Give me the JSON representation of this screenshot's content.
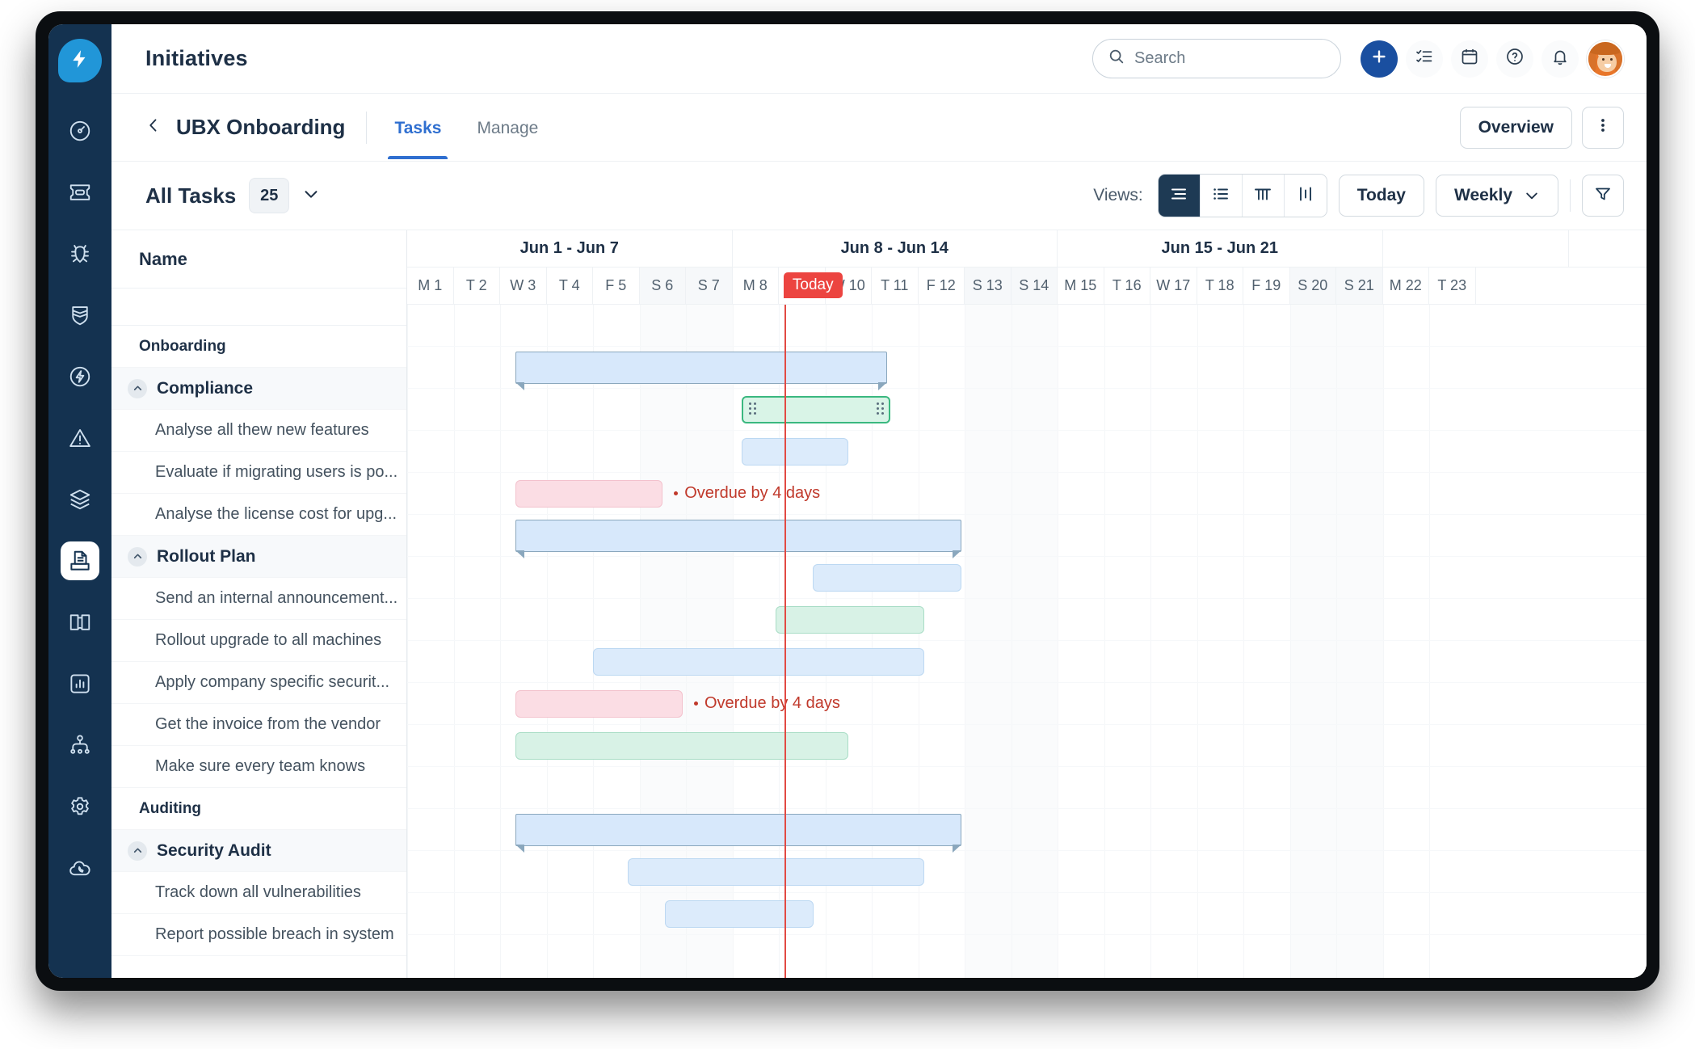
{
  "app": {
    "page_title": "Initiatives",
    "accent_blue": "#1a4fa0",
    "rail_bg": "#143250",
    "today_red": "#ec4440"
  },
  "sidebar": {
    "logo_icon": "lightning-bolt-icon",
    "items": [
      {
        "icon": "gauge-icon",
        "name": "dashboard",
        "active": false
      },
      {
        "icon": "ticket-icon",
        "name": "tickets",
        "active": false
      },
      {
        "icon": "bug-icon",
        "name": "bugs",
        "active": false
      },
      {
        "icon": "shield-icon",
        "name": "security",
        "active": false
      },
      {
        "icon": "bolt-circle-icon",
        "name": "automations",
        "active": false
      },
      {
        "icon": "warning-icon",
        "name": "incidents",
        "active": false
      },
      {
        "icon": "layers-icon",
        "name": "assets",
        "active": false
      },
      {
        "icon": "document-inbox-icon",
        "name": "initiatives",
        "active": true
      },
      {
        "icon": "book-icon",
        "name": "knowledge",
        "active": false
      },
      {
        "icon": "bar-chart-icon",
        "name": "reports",
        "active": false
      },
      {
        "icon": "org-chart-icon",
        "name": "teams",
        "active": false
      },
      {
        "icon": "gear-icon",
        "name": "settings",
        "active": false
      },
      {
        "icon": "cloud-phone-icon",
        "name": "voice",
        "active": false
      }
    ]
  },
  "header": {
    "search": {
      "placeholder": "Search",
      "value": "",
      "icon": "search-icon"
    },
    "actions": [
      {
        "icon": "plus-icon",
        "name": "create-button"
      },
      {
        "icon": "checklist-icon",
        "name": "tasks-button"
      },
      {
        "icon": "calendar-icon",
        "name": "calendar-button"
      },
      {
        "icon": "help-icon",
        "name": "help-button"
      },
      {
        "icon": "bell-icon",
        "name": "notifications-button"
      }
    ],
    "avatar_alt": "user avatar"
  },
  "subheader": {
    "back_icon": "chevron-left-icon",
    "breadcrumb": "UBX Onboarding",
    "tabs": [
      {
        "label": "Tasks",
        "selected": true
      },
      {
        "label": "Manage",
        "selected": false
      }
    ],
    "overview_label": "Overview",
    "more_icon": "kebab-menu-icon"
  },
  "toolbar": {
    "title": "All Tasks",
    "count": "25",
    "chevron_icon": "chevron-down-icon",
    "views_label": "Views:",
    "view_buttons": [
      {
        "icon": "gantt-view-icon",
        "name": "view-gantt",
        "active": true
      },
      {
        "icon": "list-view-icon",
        "name": "view-list",
        "active": false
      },
      {
        "icon": "timeline-view-icon",
        "name": "view-timeline",
        "active": false
      },
      {
        "icon": "board-view-icon",
        "name": "view-board",
        "active": false
      }
    ],
    "today_label": "Today",
    "zoom_label": "Weekly",
    "filter_icon": "filter-icon"
  },
  "gantt": {
    "name_header": "Name",
    "today_label": "Today",
    "today_day_index": 8,
    "weeks": [
      {
        "label": "Jun 1 - Jun 7",
        "days": 7
      },
      {
        "label": "Jun 8 - Jun 14",
        "days": 7
      },
      {
        "label": "Jun 15 - Jun 21",
        "days": 7
      },
      {
        "label": "",
        "days": 4
      }
    ],
    "days": [
      {
        "label": "M 1",
        "weekend": false
      },
      {
        "label": "T 2",
        "weekend": false
      },
      {
        "label": "W 3",
        "weekend": false
      },
      {
        "label": "T 4",
        "weekend": false
      },
      {
        "label": "F 5",
        "weekend": false
      },
      {
        "label": "S 6",
        "weekend": true
      },
      {
        "label": "S 7",
        "weekend": true
      },
      {
        "label": "M 8",
        "weekend": false
      },
      {
        "label": "T 9",
        "weekend": false
      },
      {
        "label": "W 10",
        "weekend": false
      },
      {
        "label": "T 11",
        "weekend": false
      },
      {
        "label": "F 12",
        "weekend": false
      },
      {
        "label": "S 13",
        "weekend": true
      },
      {
        "label": "S 14",
        "weekend": true
      },
      {
        "label": "M 15",
        "weekend": false
      },
      {
        "label": "T 16",
        "weekend": false
      },
      {
        "label": "W 17",
        "weekend": false
      },
      {
        "label": "T 18",
        "weekend": false
      },
      {
        "label": "F 19",
        "weekend": false
      },
      {
        "label": "S 20",
        "weekend": true
      },
      {
        "label": "S 21",
        "weekend": true
      },
      {
        "label": "M 22",
        "weekend": false
      },
      {
        "label": "T 23",
        "weekend": false
      }
    ],
    "rows": [
      {
        "label": "Onboarding",
        "type": "group",
        "bar": null
      },
      {
        "label": "Compliance",
        "type": "parent",
        "bar": {
          "style": "summary",
          "start": 2.33,
          "end": 10.33
        }
      },
      {
        "label": "Analyse all thew new features",
        "type": "child",
        "bar": {
          "style": "selected",
          "start": 7.2,
          "end": 10.4,
          "grips": true
        }
      },
      {
        "label": "Evaluate if migrating users is po...",
        "type": "child",
        "bar": {
          "style": "blue",
          "start": 7.2,
          "end": 9.5
        }
      },
      {
        "label": "Analyse the license cost for upg...",
        "type": "child",
        "bar": {
          "style": "pink",
          "start": 2.33,
          "end": 5.5
        },
        "note": "Overdue by 4 days"
      },
      {
        "label": "Rollout Plan",
        "type": "parent",
        "bar": {
          "style": "summary",
          "start": 2.33,
          "end": 11.93
        }
      },
      {
        "label": "Send an internal announcement...",
        "type": "child",
        "bar": {
          "style": "blue",
          "start": 8.73,
          "end": 11.93
        }
      },
      {
        "label": "Rollout upgrade to all machines",
        "type": "child",
        "bar": {
          "style": "green",
          "start": 7.93,
          "end": 11.13
        }
      },
      {
        "label": "Apply company specific securit...",
        "type": "child",
        "bar": {
          "style": "blue",
          "start": 4.0,
          "end": 11.13
        }
      },
      {
        "label": "Get the invoice from the vendor",
        "type": "child",
        "bar": {
          "style": "pink",
          "start": 2.33,
          "end": 5.93
        },
        "note": "Overdue by 4 days"
      },
      {
        "label": "Make sure every team knows",
        "type": "child",
        "bar": {
          "style": "green",
          "start": 2.33,
          "end": 9.5
        }
      },
      {
        "label": "Auditing",
        "type": "group",
        "bar": null
      },
      {
        "label": "Security Audit",
        "type": "parent",
        "bar": {
          "style": "summary",
          "start": 2.33,
          "end": 11.93
        }
      },
      {
        "label": "Track down all vulnerabilities",
        "type": "child",
        "bar": {
          "style": "blue",
          "start": 4.75,
          "end": 11.13
        }
      },
      {
        "label": "Report possible breach in system",
        "type": "child",
        "bar": {
          "style": "blue",
          "start": 5.55,
          "end": 8.75
        }
      }
    ]
  }
}
